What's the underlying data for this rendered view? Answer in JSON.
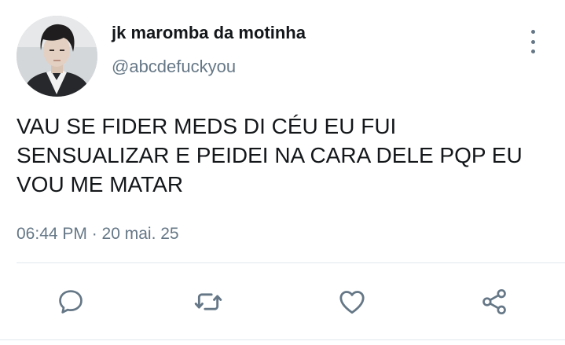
{
  "author": {
    "display_name": "jk maromba da motinha",
    "handle": "@abcdefuckyou",
    "avatar": "profile-photo"
  },
  "tweet": {
    "lines": [
      "VAU SE FIDER MEDS DI CÉU EU FUI",
      "SENSUALIZAR E PEIDEI NA CARA DELE PQP EU",
      "VOU ME MATAR"
    ],
    "timestamp": "06:44 PM · 20 mai. 25"
  },
  "icons": {
    "more": "vertical-ellipsis-icon",
    "reply": "speech-bubble-icon",
    "retweet": "retweet-arrows-icon",
    "like": "heart-icon",
    "share": "share-nodes-icon"
  },
  "colors": {
    "text": "#14171a",
    "secondary": "#657786",
    "divider": "#e1e8ed"
  }
}
